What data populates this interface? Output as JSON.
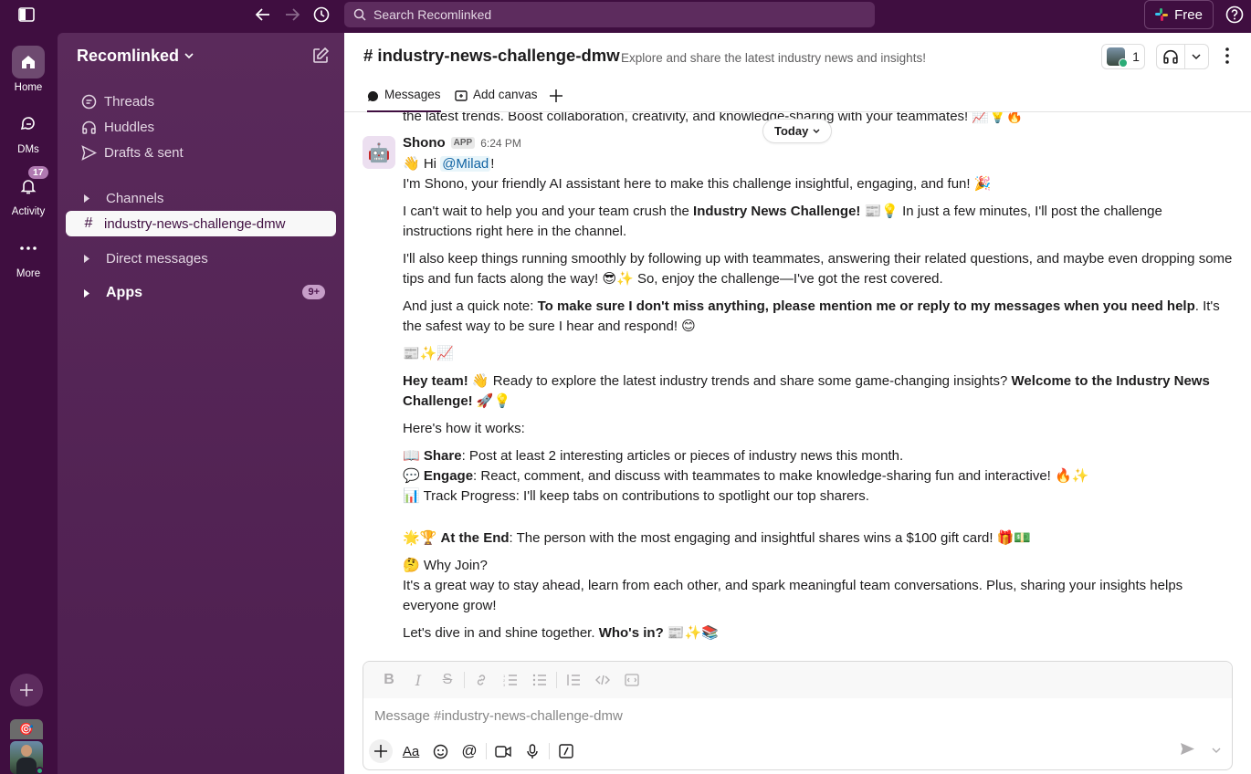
{
  "topbar": {
    "search_placeholder": "Search Recomlinked",
    "free_label": "Free"
  },
  "rail": {
    "home": "Home",
    "dms": "DMs",
    "activity": "Activity",
    "activity_badge": "17",
    "more": "More"
  },
  "sidebar": {
    "workspace": "Recomlinked",
    "threads": "Threads",
    "huddles": "Huddles",
    "drafts": "Drafts & sent",
    "channels": "Channels",
    "active_channel": "industry-news-challenge-dmw",
    "direct_messages": "Direct messages",
    "apps": "Apps",
    "apps_badge": "9+"
  },
  "header": {
    "channel_name": "# industry-news-challenge-dmw",
    "topic": "Explore and share the latest industry news and insights!",
    "member_count": "1"
  },
  "tabs": {
    "messages": "Messages",
    "add_canvas": "Add canvas"
  },
  "messages": {
    "prev_line": "the latest trends. Boost collaboration, creativity, and knowledge-sharing with your teammates! 📈💡🔥",
    "date_divider": "Today",
    "sender": "Shono",
    "app_tag": "APP",
    "time": "6:24 PM",
    "hi_prefix": "👋 Hi ",
    "mention": "@Milad",
    "hi_suffix": "!",
    "intro": "I'm Shono, your friendly AI assistant here to make this challenge insightful, engaging, and fun! 🎉",
    "p2_a": "I can't wait to help you and your team crush the ",
    "p2_b": "Industry News Challenge!",
    "p2_c": " 📰💡 In just a few minutes, I'll post the challenge instructions right here in the channel.",
    "p3": "I'll also keep things running smoothly by following up with teammates, answering their related questions, and maybe even dropping some tips and fun facts along the way! 😎✨ So, enjoy the challenge—I've got the rest covered.",
    "p4_a": "And just a quick note: ",
    "p4_b": "To make sure I don't miss anything, please mention me or reply to my messages when you need help",
    "p4_c": ". It's the safest way to be sure I hear and respond! 😊",
    "emoji_row": "📰✨📈",
    "p5_a": "Hey team!",
    "p5_b": " 👋 Ready to explore the latest industry trends and share some game-changing insights? ",
    "p5_c": "Welcome to the Industry News Challenge!",
    "p5_d": " 🚀💡",
    "how": "Here's how it works:",
    "share_icon": "📖 ",
    "share_b": "Share",
    "share_t": ": Post at least 2 interesting articles or pieces of industry news this month.",
    "engage_icon": "💬 ",
    "engage_b": "Engage",
    "engage_t": ": React, comment, and discuss with teammates to make knowledge-sharing fun and interactive! 🔥✨",
    "track": "📊 Track Progress: I'll keep tabs on contributions to spotlight our top sharers.",
    "end_icon": "🌟🏆 ",
    "end_b": "At the End",
    "end_t": ": The person with the most engaging and insightful shares wins a $100 gift card! 🎁💵",
    "why": "🤔 Why Join?",
    "why_t": "It's a great way to stay ahead, learn from each other, and spark meaningful team conversations. Plus, sharing your insights helps everyone grow!",
    "final_a": "Let's dive in and shine together. ",
    "final_b": "Who's in?",
    "final_c": " 📰✨📚"
  },
  "composer": {
    "placeholder": "Message #industry-news-challenge-dmw"
  }
}
